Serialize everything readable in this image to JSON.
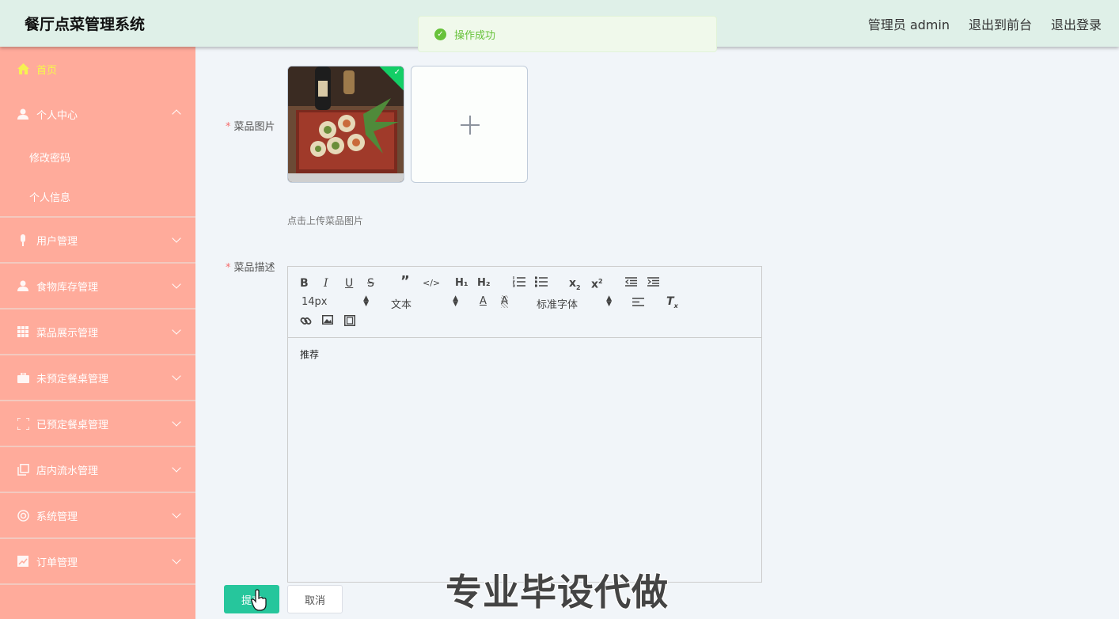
{
  "header": {
    "title": "餐厅点菜管理系统",
    "user": "管理员 admin",
    "to_front": "退出到前台",
    "logout": "退出登录"
  },
  "toast": {
    "message": "操作成功",
    "color": "#67c23a"
  },
  "sidebar": {
    "bg_color": "#ffab9b",
    "active_color": "#f6f94a",
    "home": "首页",
    "personal": {
      "label": "个人中心",
      "children": [
        "修改密码",
        "个人信息"
      ]
    },
    "items": [
      "用户管理",
      "食物库存管理",
      "菜品展示管理",
      "未预定餐桌管理",
      "已预定餐桌管理",
      "店内流水管理",
      "系统管理",
      "订单管理"
    ]
  },
  "form": {
    "image_label": "菜品图片",
    "upload_tip": "点击上传菜品图片",
    "desc_label": "菜品描述",
    "editor": {
      "font_size": "14px",
      "block_type": "文本",
      "font_family": "标准字体",
      "content": "推荐"
    },
    "submit": "提交",
    "cancel": "取消"
  },
  "watermark": "专业毕设代做",
  "accent_color": "#26c69c"
}
